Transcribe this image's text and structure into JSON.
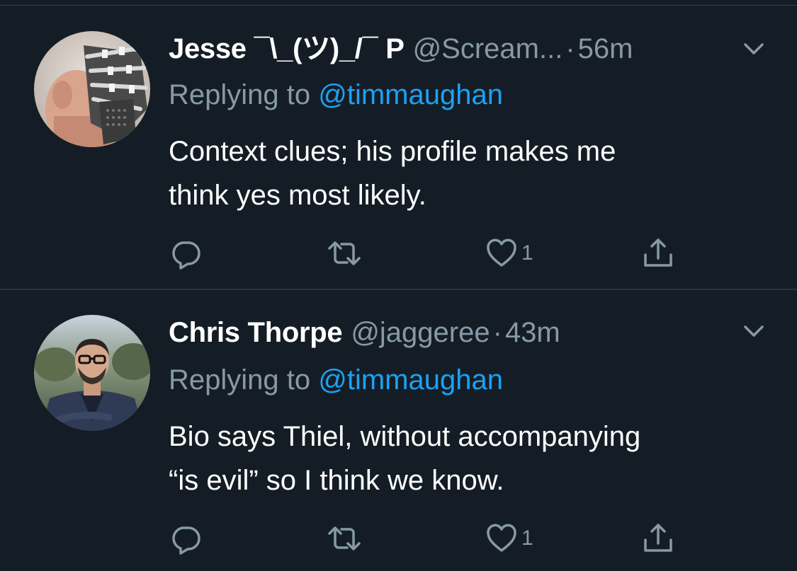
{
  "tweets": [
    {
      "name": "Jesse ¯\\_(ツ)_/¯ P",
      "handle": "@Scream...",
      "time": "56m",
      "replying_prefix": "Replying to ",
      "replying_to": "@timmaughan",
      "body_lines": [
        "Context clues; his profile makes me",
        "think yes most likely."
      ],
      "like_count": "1",
      "avatar_icon": "avatar-masked-person-icon"
    },
    {
      "name": "Chris Thorpe",
      "handle": "@jaggeree",
      "time": "43m",
      "replying_prefix": "Replying to ",
      "replying_to": "@timmaughan",
      "body_lines": [
        "Bio says Thiel, without accompanying",
        "“is evil” so I think we know."
      ],
      "like_count": "1",
      "avatar_icon": "avatar-person-glasses-icon"
    }
  ],
  "colors": {
    "background": "#141d26",
    "text_primary": "#ffffff",
    "text_secondary": "#8899a6",
    "link": "#1da1f2",
    "divider": "#2a343f"
  },
  "icons": [
    "reply-icon",
    "retweet-icon",
    "like-icon",
    "share-icon",
    "chevron-down-icon"
  ]
}
